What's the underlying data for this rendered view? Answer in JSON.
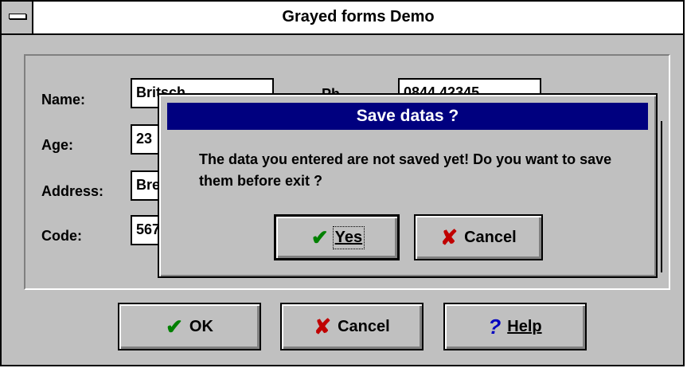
{
  "window": {
    "title": "Grayed forms Demo"
  },
  "form": {
    "name": {
      "label": "Name:",
      "value": "Britsch"
    },
    "phone": {
      "label": "Ph",
      "value": "0844 42345"
    },
    "age": {
      "label": "Age:",
      "value": "23"
    },
    "address": {
      "label": "Address:",
      "value": "Bre"
    },
    "code": {
      "label": "Code:",
      "value": "567"
    }
  },
  "buttons": {
    "ok": "OK",
    "cancel": "Cancel",
    "help": "Help"
  },
  "dialog": {
    "title": "Save datas ?",
    "message": "The data  you entered are not saved yet! Do you want to save them before exit ?",
    "yes": "Yes",
    "cancel": "Cancel"
  },
  "icons": {
    "check_color": "#008000",
    "cross_color": "#c00000",
    "help_color": "#0000c0"
  }
}
